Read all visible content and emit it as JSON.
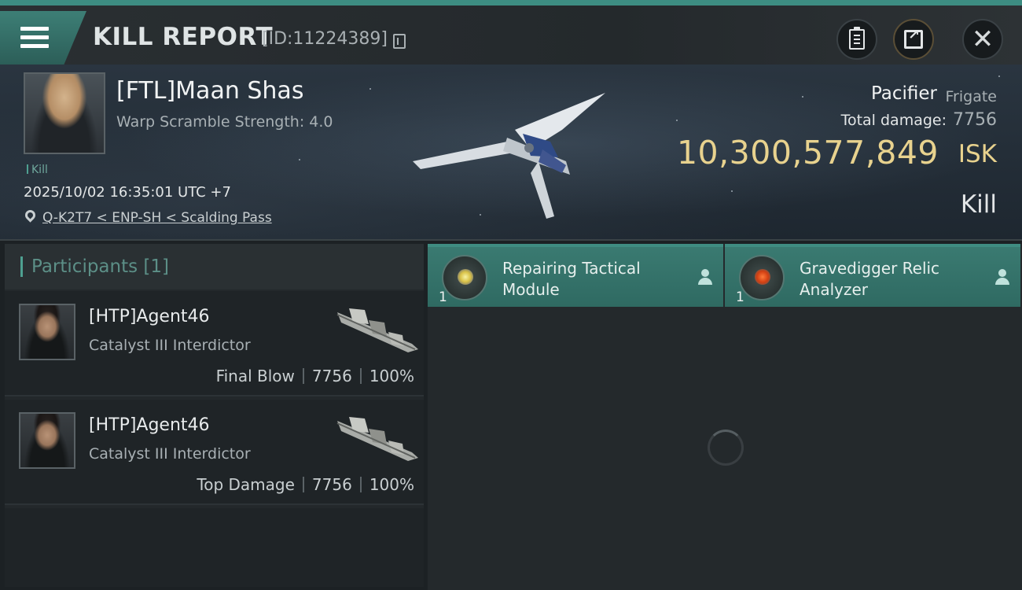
{
  "header": {
    "title": "KILL REPORT",
    "report_id": "[ID:11224389]"
  },
  "victim": {
    "name": "[FTL]Maan Shas",
    "warp_scramble": "Warp Scramble Strength: 4.0",
    "tag": "Kill",
    "datetime": "2025/10/02 16:35:01 UTC +7",
    "location": "Q-K2T7 < ENP-SH < Scalding Pass",
    "ship_name": "Pacifier",
    "ship_class": "Frigate",
    "total_damage_label": "Total damage:",
    "total_damage_value": "7756",
    "isk_value": "10,300,577,849",
    "isk_unit": "ISK",
    "result": "Kill"
  },
  "participants": {
    "title": "Participants [1]",
    "items": [
      {
        "name": "[HTP]Agent46",
        "ship": "Catalyst III Interdictor",
        "role": "Final Blow",
        "damage": "7756",
        "percent": "100%"
      },
      {
        "name": "[HTP]Agent46",
        "ship": "Catalyst III Interdictor",
        "role": "Top Damage",
        "damage": "7756",
        "percent": "100%"
      }
    ]
  },
  "modules": [
    {
      "name": "Repairing Tactical Module",
      "quantity": "1",
      "icon": "repair-module-icon"
    },
    {
      "name": "Gravedigger Relic Analyzer",
      "quantity": "1",
      "icon": "relic-analyzer-icon"
    }
  ],
  "colors": {
    "accent_teal": "#3d8d82",
    "isk_gold": "#e8d28e",
    "module_bg": "#3a7a71"
  }
}
